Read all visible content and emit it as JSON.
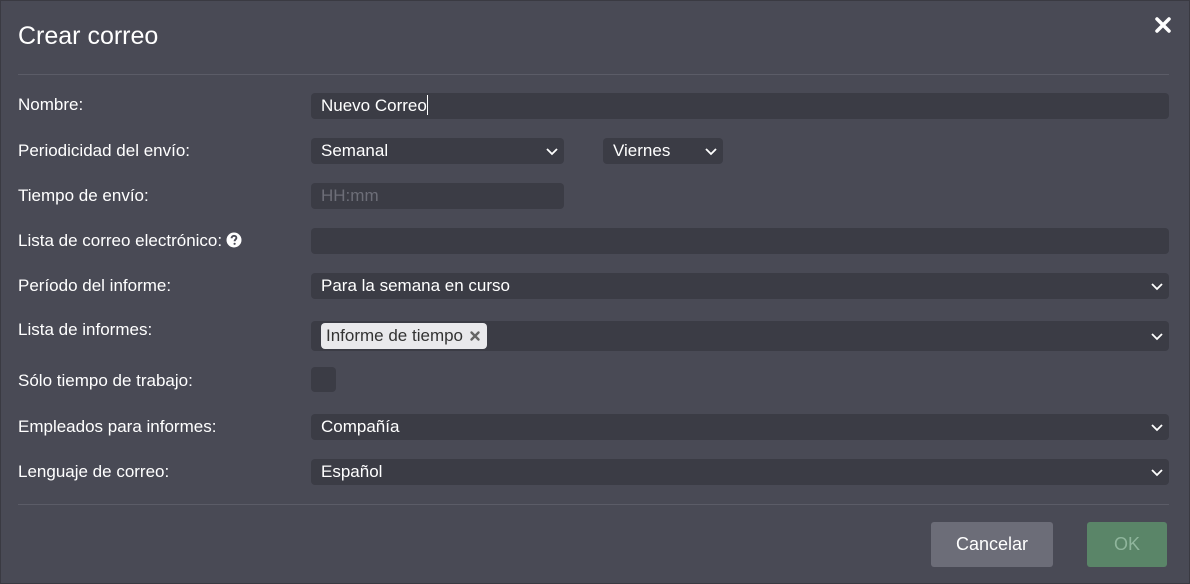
{
  "dialog": {
    "title": "Crear correo",
    "close_icon": "close-icon"
  },
  "form": {
    "name_label": "Nombre:",
    "name_value": "Nuevo Correo",
    "frequency_label": "Periodicidad del envío:",
    "frequency_value": "Semanal",
    "weekday_value": "Viernes",
    "send_time_label": "Tiempo de envío:",
    "send_time_placeholder": "HH:mm",
    "email_list_label": "Lista de correo electrónico:",
    "email_list_value": "",
    "report_period_label": "Período del informe:",
    "report_period_value": "Para la semana en curso",
    "report_list_label": "Lista de informes:",
    "report_list_tags": [
      "Informe de tiempo"
    ],
    "work_time_only_label": "Sólo tiempo de trabajo:",
    "work_time_only_checked": false,
    "employees_label": "Empleados para informes:",
    "employees_value": "Compañía",
    "language_label": "Lenguaje de correo:",
    "language_value": "Español"
  },
  "buttons": {
    "cancel_label": "Cancelar",
    "ok_label": "OK"
  },
  "colors": {
    "background": "#494a55",
    "field_background": "#3b3c45",
    "cancel_button": "#6c6d78",
    "ok_button": "#5a8568"
  }
}
